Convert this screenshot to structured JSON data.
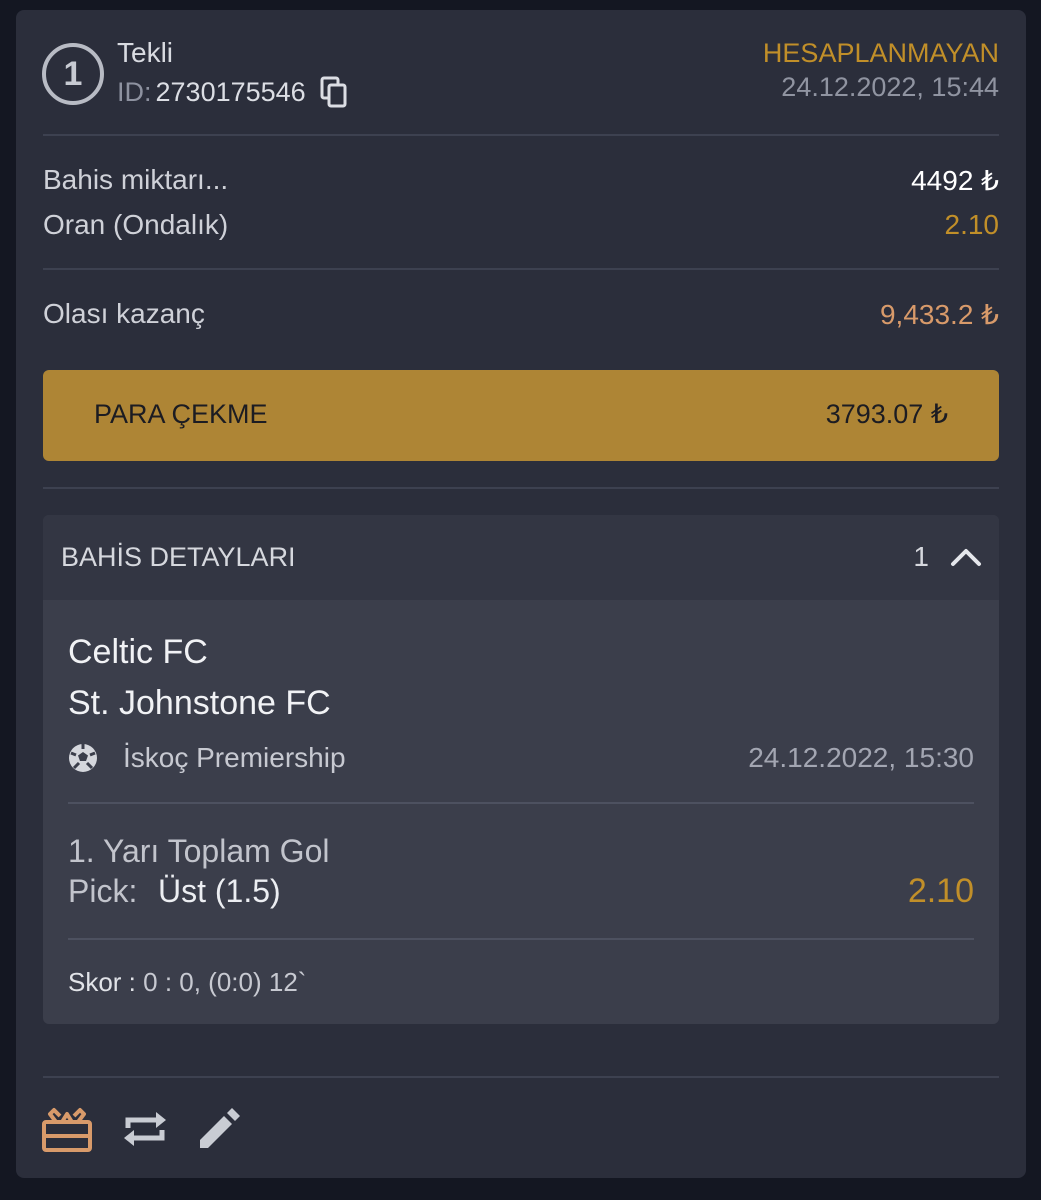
{
  "header": {
    "badge": "1",
    "bet_type": "Tekli",
    "id_label": "ID:",
    "id_value": "2730175546",
    "status": "HESAPLANMAYAN",
    "datetime": "24.12.2022, 15:44"
  },
  "summary": {
    "stake_label": "Bahis miktarı...",
    "stake_value": "4492 ₺",
    "odds_label": "Oran (Ondalık)",
    "odds_value": "2.10",
    "potential_label": "Olası kazanç",
    "potential_value": "9,433.2 ₺"
  },
  "cashout": {
    "label": "PARA ÇEKME",
    "amount": "3793.07 ₺"
  },
  "details": {
    "title": "BAHİS DETAYLARI",
    "count": "1",
    "home_team": "Celtic FC",
    "away_team": "St. Johnstone FC",
    "league": "İskoç Premiership",
    "match_datetime": "24.12.2022, 15:30",
    "market": "1. Yarı Toplam Gol",
    "pick_label": "Pick:",
    "pick_value": "Üst (1.5)",
    "pick_odds": "2.10",
    "score_label": "Skor :",
    "score_value": " 0 : 0, (0:0) 12`"
  },
  "colors": {
    "accent": "#c18f29",
    "cashout_bg": "#ae8535",
    "potential": "#d89a6a",
    "card_bg": "#2b2e3b"
  },
  "footer": {
    "icons": [
      "gift-icon",
      "repeat-icon",
      "edit-icon"
    ]
  }
}
